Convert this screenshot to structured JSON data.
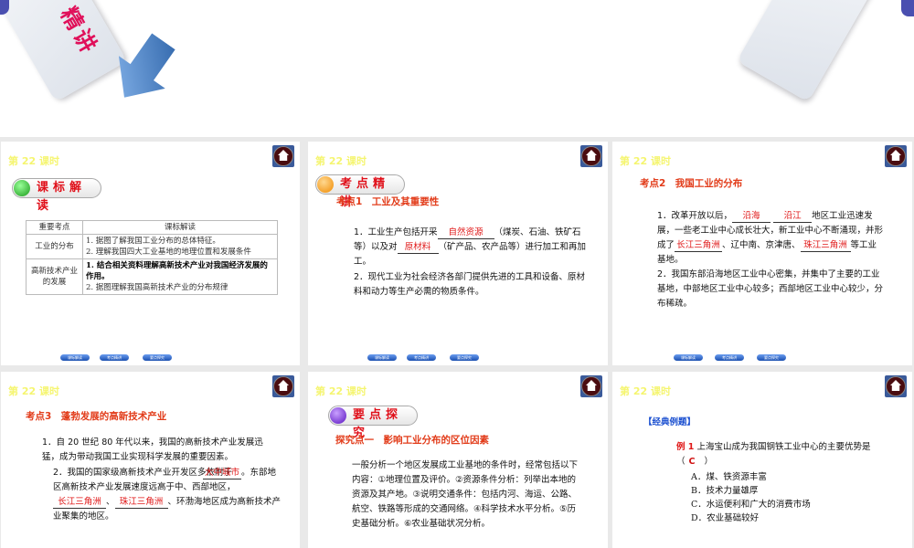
{
  "top_slide": {
    "title_fragment": "精讲"
  },
  "lesson_label": "第 22 课时",
  "nav": [
    "课标解读",
    "考点精讲",
    "要点探究"
  ],
  "slide1": {
    "badge": "课标解读",
    "table": {
      "headers": [
        "重要考点",
        "课标解读"
      ],
      "rows": [
        {
          "topic": "工业的分布",
          "items": [
            "1. 据图了解我国工业分布的总体特征。",
            "2. 理解我国四大工业基地的地理位置和发展条件"
          ]
        },
        {
          "topic": "高新技术产业的发展",
          "items": [
            "1. 结合相关资料理解高新技术产业对我国经济发展的作用。",
            "2. 据图理解我国高新技术产业的分布规律"
          ]
        }
      ]
    }
  },
  "slide2": {
    "badge": "考点精讲",
    "heading": "考点1　工业及其重要性",
    "p1a": "1．工业生产包括开采",
    "blank1": "自然资源",
    "p1b": "（煤炭、石油、铁矿石等）以及对",
    "blank2": "原材料",
    "p1c": "（矿产品、农产品等）进行加工和再加工。",
    "p2": "2．现代工业为社会经济各部门提供先进的工具和设备、原材料和动力等生产必需的物质条件。"
  },
  "slide3": {
    "heading": "考点2　我国工业的分布",
    "p1a": "1．改革开放以后，",
    "blank1": "沿海",
    "blank2": "沿江",
    "p1b": "地区工业迅速发展，一些老工业中心成长壮大，新工业中心不断涌现，并形成了",
    "blank3": "长江三角洲",
    "p1c": "、辽中南、京津唐、",
    "blank4": "珠江三角洲",
    "p1d": "等工业基地。",
    "p2": "2．我国东部沿海地区工业中心密集，并集中了主要的工业基地，中部地区工业中心较多；西部地区工业中心较少，分布稀疏。"
  },
  "slide4": {
    "heading": "考点3　蓬勃发展的高新技术产业",
    "p1": "1．自 20 世纪 80 年代以来，我国的高新技术产业发展迅猛，成为带动我国工业实现科学发展的重要因素。",
    "p2a": "2．我国的国家级高新技术产业开发区多依附于",
    "blank1": "大中城市",
    "p2b": "。东部地区高新技术产业发展速度远高于中、西部地区，",
    "blank2": "长江三角洲",
    "sep": "、",
    "blank3": "珠江三角洲",
    "p2c": "、环渤海地区成为高新技术产业聚集的地区。"
  },
  "slide5": {
    "badge": "要点探究",
    "heading": "探究点一　影响工业分布的区位因素",
    "p1": "一般分析一个地区发展成工业基地的条件时，经常包括以下内容：①地理位置及评价。②资源条件分析：列举出本地的资源及其产地。③说明交通条件：包括内河、海运、公路、航空、铁路等形成的交通网络。④科学技术水平分析。⑤历史基础分析。⑥农业基础状况分析。"
  },
  "slide6": {
    "section": "【经典例题】",
    "example_label": "例 1",
    "question": "上海宝山成为我国钢铁工业中心的主要优势是（",
    "answer": "C",
    "close": "）",
    "options": [
      "A．煤、铁资源丰富",
      "B．技术力量雄厚",
      "C．水运便利和广大的消费市场",
      "D．农业基础较好"
    ]
  }
}
